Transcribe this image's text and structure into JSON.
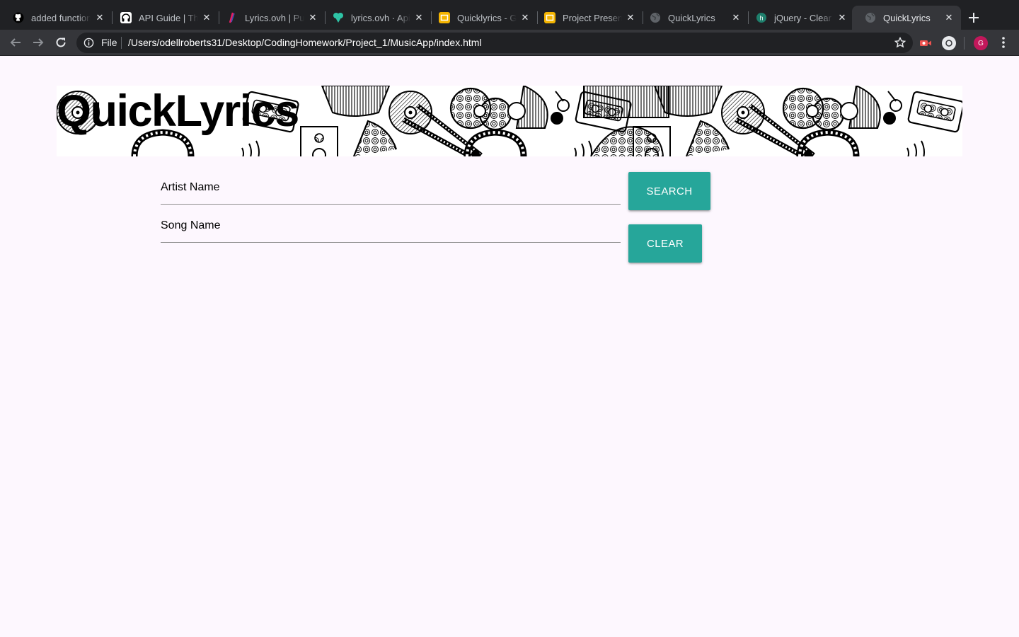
{
  "browser": {
    "tabs": [
      {
        "title": "added function",
        "favicon": "github-icon"
      },
      {
        "title": "API Guide | The",
        "favicon": "headphones-icon"
      },
      {
        "title": "Lyrics.ovh | Pub",
        "favicon": "lyrics-icon"
      },
      {
        "title": "lyrics.ovh · Apia",
        "favicon": "apiary-icon"
      },
      {
        "title": "Quicklyrics - Go",
        "favicon": "slides-icon"
      },
      {
        "title": "Project Presenta",
        "favicon": "slides-icon"
      },
      {
        "title": "QuickLyrics",
        "favicon": "globe-icon"
      },
      {
        "title": "jQuery - Clear A",
        "favicon": "stackblitz-icon"
      },
      {
        "title": "QuickLyrics",
        "favicon": "globe-icon",
        "active": true
      }
    ],
    "address": {
      "scheme_label": "File",
      "url": "/Users/odellroberts31/Desktop/CodingHomework/Project_1/MusicApp/index.html"
    },
    "profile_initial": "G",
    "colors": {
      "tab_bar": "#202124",
      "toolbar": "#35363a",
      "profile": "#c2185b",
      "slides": "#f4b400"
    }
  },
  "page": {
    "title": "QuickLyrics",
    "artist_placeholder": "Artist Name",
    "song_placeholder": "Song Name",
    "search_button": "SEARCH",
    "clear_button": "CLEAR",
    "colors": {
      "background": "#fdf7fe",
      "button": "#26a69a"
    }
  }
}
